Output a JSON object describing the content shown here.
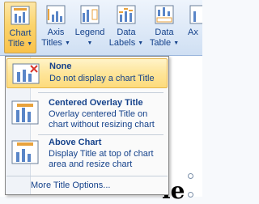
{
  "ribbon": {
    "buttons": [
      {
        "label1": "Chart",
        "label2": "Title",
        "icon": "chart-title-icon"
      },
      {
        "label1": "Axis",
        "label2": "Titles",
        "icon": "axis-titles-icon"
      },
      {
        "label1": "Legend",
        "label2": "",
        "icon": "legend-icon"
      },
      {
        "label1": "Data",
        "label2": "Labels",
        "icon": "data-labels-icon"
      },
      {
        "label1": "Data",
        "label2": "Table",
        "icon": "data-table-icon"
      },
      {
        "label1": "Ax",
        "label2": "",
        "icon": "axes-icon"
      }
    ]
  },
  "menu": {
    "items": [
      {
        "title": "None",
        "desc1": "Do not display a chart Title",
        "desc2": ""
      },
      {
        "title": "Centered Overlay Title",
        "desc1": "Overlay centered Title on",
        "desc2": "chart without resizing chart"
      },
      {
        "title": "Above Chart",
        "desc1": "Display Title at top of chart",
        "desc2": "area and resize chart"
      }
    ],
    "more": "More Title Options..."
  },
  "document": {
    "visible_text": "le"
  },
  "colors": {
    "accent": "#15428b",
    "highlight": "#fddb7c",
    "ribbon": "#dce8f7"
  }
}
